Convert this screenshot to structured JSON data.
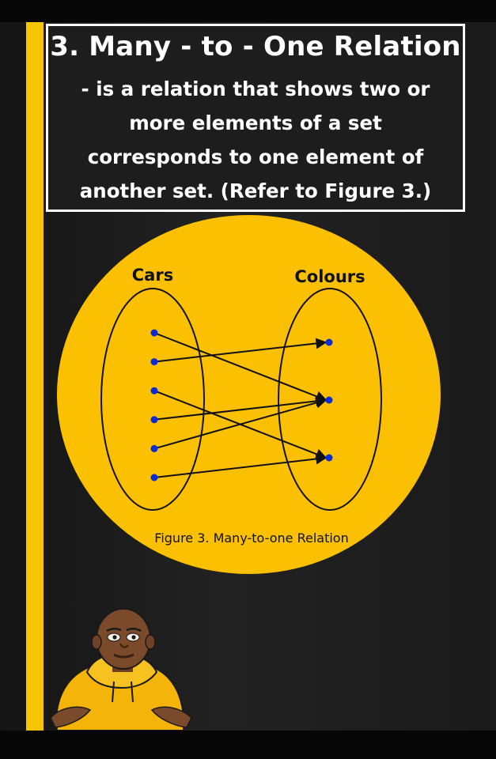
{
  "heading": {
    "title": "3. Many - to - One Relation",
    "description": "- is a relation that shows two or\nmore elements of a set\ncorresponds to one element of\nanother set.  (Refer to Figure 3.)"
  },
  "figure": {
    "domain_label": "Cars",
    "codomain_label": "Colours",
    "caption": "Figure 3. Many-to-one Relation",
    "domain_count": 6,
    "codomain_count": 3,
    "mappings": [
      [
        0,
        1
      ],
      [
        1,
        0
      ],
      [
        2,
        2
      ],
      [
        3,
        1
      ],
      [
        4,
        1
      ],
      [
        5,
        2
      ]
    ]
  },
  "colors": {
    "accent": "#f7c400",
    "circle": "#fcc002",
    "dot": "#0a2bd8",
    "text": "#ffffff"
  }
}
